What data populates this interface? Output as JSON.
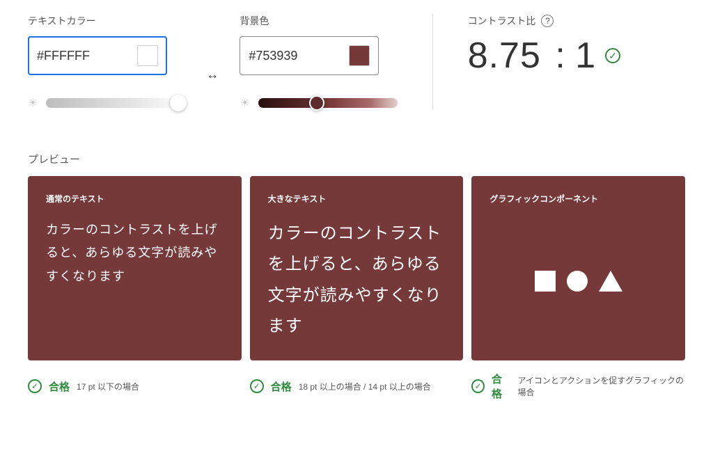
{
  "labels": {
    "text_color": "テキストカラー",
    "background": "背景色",
    "contrast_ratio": "コントラスト比",
    "preview": "プレビュー"
  },
  "colors": {
    "text_hex": "#FFFFFF",
    "bg_hex": "#753939"
  },
  "contrast": {
    "value": "8.75",
    "suffix": " : 1"
  },
  "cards": {
    "normal": {
      "label": "通常のテキスト",
      "body": "カラーのコントラストを上げると、あらゆる文字が読みやすくなります",
      "pass": "合格",
      "desc": "17 pt 以下の場合"
    },
    "large": {
      "label": "大きなテキスト",
      "body": "カラーのコントラストを上げると、あらゆる文字が読みやすくなります",
      "pass": "合格",
      "desc": "18 pt 以上の場合 / 14 pt 以上の場合"
    },
    "graphic": {
      "label": "グラフィックコンポーネント",
      "pass": "合格",
      "desc": "アイコンとアクションを促すグラフィックの場合"
    }
  }
}
